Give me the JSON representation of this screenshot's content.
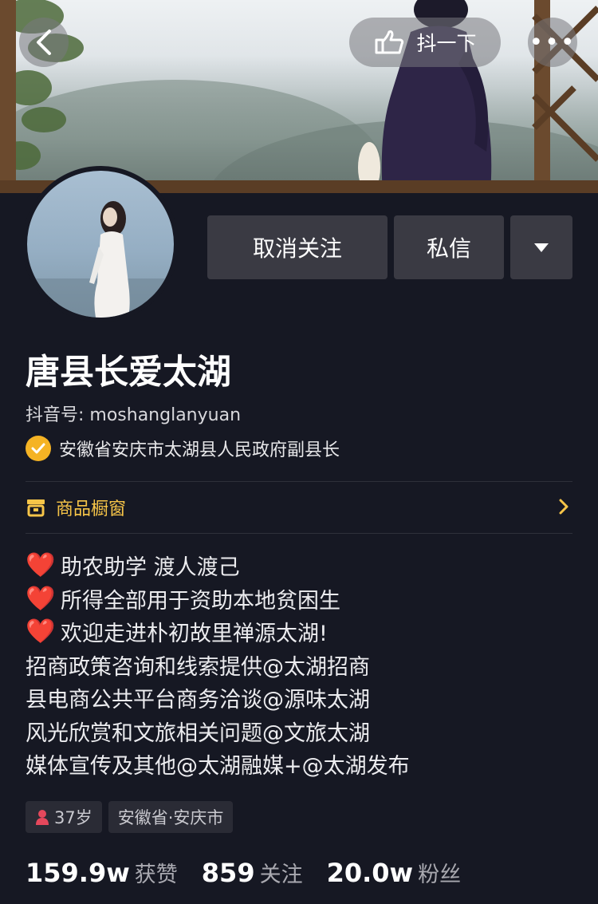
{
  "header": {
    "back_icon": "chevron-left-icon",
    "shake_icon": "hand-point-icon",
    "shake_label": "抖一下",
    "more_icon": "more-dots-icon",
    "more_label": "•••"
  },
  "profile": {
    "name": "唐县长爱太湖",
    "douyin_id": "抖音号: moshanglanyuan",
    "verification": "安徽省安庆市太湖县人民政府副县长",
    "verification_color": "#f5b324"
  },
  "actions": {
    "unfollow_label": "取消关注",
    "message_label": "私信",
    "more_icon": "triangle-down-icon"
  },
  "shop": {
    "label": "商品橱窗",
    "color": "#f7c548"
  },
  "bio": {
    "lines": [
      {
        "heart": true,
        "text": "助农助学 渡人渡己"
      },
      {
        "heart": true,
        "text": "所得全部用于资助本地贫困生"
      },
      {
        "heart": true,
        "text": "欢迎走进朴初故里禅源太湖!"
      },
      {
        "heart": false,
        "text": "招商政策咨询和线索提供@太湖招商"
      },
      {
        "heart": false,
        "text": "县电商公共平台商务洽谈@源味太湖"
      },
      {
        "heart": false,
        "text": "风光欣赏和文旅相关问题@文旅太湖"
      },
      {
        "heart": false,
        "text": "媒体宣传及其他@太湖融媒+@太湖发布"
      }
    ],
    "heart_glyph": "❤️"
  },
  "tags": {
    "age": "37岁",
    "location": "安徽省·安庆市"
  },
  "stats": [
    {
      "value": "159.9w",
      "label": "获赞"
    },
    {
      "value": "859",
      "label": "关注"
    },
    {
      "value": "20.0w",
      "label": "粉丝"
    }
  ]
}
